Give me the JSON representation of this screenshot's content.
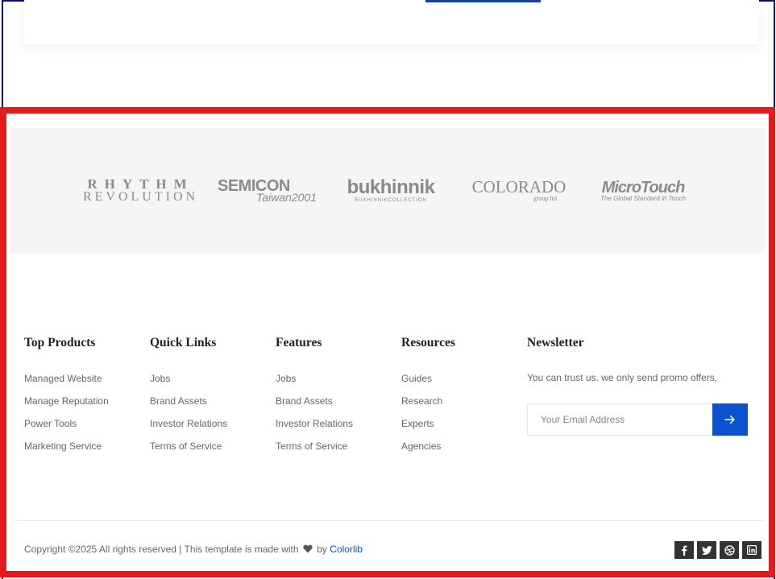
{
  "brands": {
    "rhythm": {
      "line1": "RHYTHM",
      "line2": "REVOLUTION"
    },
    "semicon": {
      "line1": "SEMICON",
      "line2": "Taiwan2001"
    },
    "bukhinnik": {
      "line1": "bukhinnik",
      "line2": "BUKHINNIKCOLLECTION"
    },
    "colorado": {
      "line1": "COLORADO",
      "line2": "group ltd"
    },
    "microtouch": {
      "line1": "MicroTouch",
      "line2": "The Global Standard in Touch"
    }
  },
  "footer": {
    "columns": [
      {
        "title": "Top Products",
        "links": [
          "Managed Website",
          "Manage Reputation",
          "Power Tools",
          "Marketing Service"
        ]
      },
      {
        "title": "Quick Links",
        "links": [
          "Jobs",
          "Brand Assets",
          "Investor Relations",
          "Terms of Service"
        ]
      },
      {
        "title": "Features",
        "links": [
          "Jobs",
          "Brand Assets",
          "Investor Relations",
          "Terms of Service"
        ]
      },
      {
        "title": "Resources",
        "links": [
          "Guides",
          "Research",
          "Experts",
          "Agencies"
        ]
      }
    ],
    "newsletter": {
      "title": "Newsletter",
      "text": "You can trust us. we only send promo offers,",
      "placeholder": "Your Email Address"
    },
    "copyright_prefix": "Copyright ©2025 All rights reserved | This template is made with",
    "copyright_by": "by",
    "credit": "Colorlib",
    "socials": [
      "facebook-icon",
      "twitter-icon",
      "dribbble-icon",
      "linkedin-icon"
    ]
  },
  "colors": {
    "accent": "#0a52d0",
    "highlight_border": "#e31b1b",
    "page_border": "#0b0b6e"
  }
}
